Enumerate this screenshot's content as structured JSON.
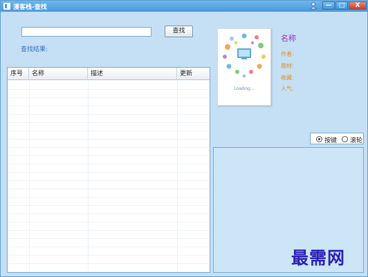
{
  "window": {
    "title": "漫客栈-查找",
    "controls": {
      "minimize": "—",
      "maximize": "□",
      "close": "X"
    }
  },
  "search": {
    "input_value": "",
    "button_label": "查找",
    "result_label": "查找结果:"
  },
  "table": {
    "columns": [
      {
        "label": "序号"
      },
      {
        "label": "名称"
      },
      {
        "label": "描述"
      },
      {
        "label": "更新"
      }
    ],
    "rows": []
  },
  "detail": {
    "cover_loading": "Loading...",
    "name_label": "名称",
    "author_label": "作者:",
    "genre_label": "题材:",
    "favorites_label": "收藏:",
    "popularity_label": "人气:"
  },
  "scroll_mode": {
    "options": [
      "按键",
      "滚轮"
    ],
    "selected": "按键"
  },
  "watermark": "最需网",
  "colors": {
    "titlebar": "#4a98dc",
    "window_bg": "#c5e0f5",
    "link": "#2e6fc2",
    "name": "#9b2fb7",
    "field": "#e28b1f",
    "watermark": "#2a1fb8"
  }
}
